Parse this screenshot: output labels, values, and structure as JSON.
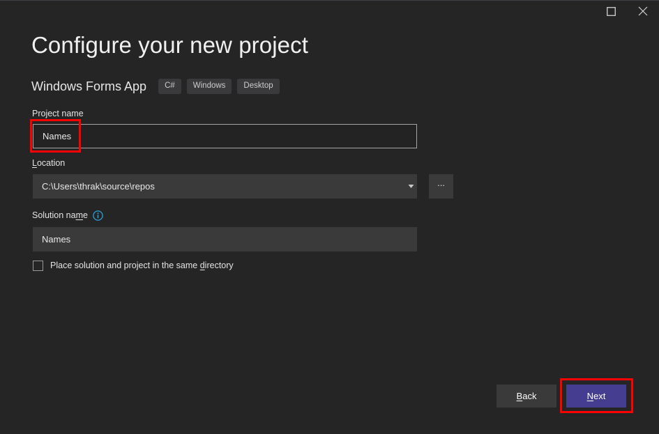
{
  "window": {
    "background": "#252526",
    "controls": [
      {
        "name": "maximize",
        "icon": "square-icon",
        "label": "Maximize"
      },
      {
        "name": "close",
        "icon": "close-icon",
        "label": "Close"
      }
    ]
  },
  "header": {
    "title": "Configure your new project",
    "template_name": "Windows Forms App",
    "tags": [
      "C#",
      "Windows",
      "Desktop"
    ]
  },
  "form": {
    "project_name": {
      "label": "Project name",
      "value": "Names",
      "placeholder": ""
    },
    "location": {
      "label_before": "",
      "label_mnemonic": "L",
      "label_after": "ocation",
      "value": "C:\\Users\\thrak\\source\\repos",
      "placeholder": "",
      "browse_label": "..."
    },
    "solution_name": {
      "label_before": "Solution na",
      "label_mnemonic": "m",
      "label_after": "e",
      "info_icon": "info-icon",
      "value": "Names",
      "placeholder": ""
    },
    "same_directory": {
      "label_before": "Place solution and project in the same ",
      "label_mnemonic": "d",
      "label_after": "irectory",
      "checked": false
    }
  },
  "footer": {
    "back": {
      "before": "",
      "mnemonic": "B",
      "after": "ack"
    },
    "next": {
      "before": "",
      "mnemonic": "N",
      "after": "ext",
      "accent": "#453d8f"
    }
  },
  "annotations": {
    "accent": "#ff0000",
    "items": [
      "project-name-input",
      "next-button"
    ]
  }
}
